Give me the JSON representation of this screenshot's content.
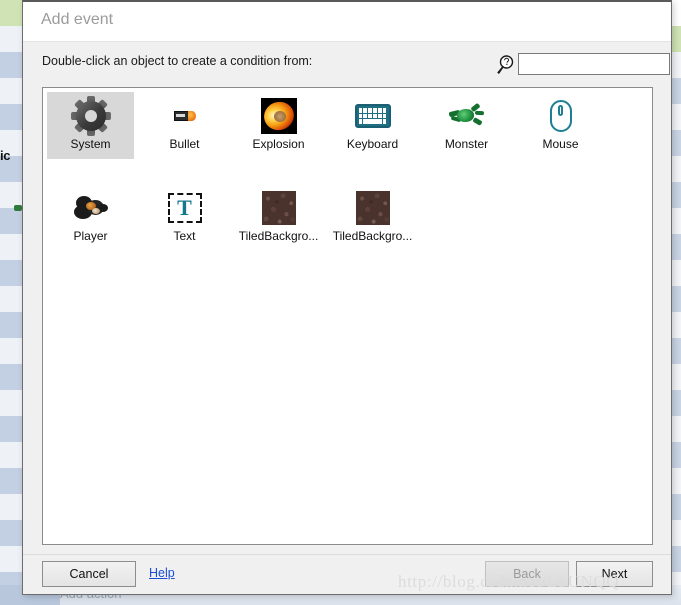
{
  "dialog": {
    "title": "Add event",
    "instruction": "Double-click an object to create a condition from:",
    "search": {
      "icon": "search-help-icon",
      "value": "",
      "placeholder": ""
    },
    "objects": [
      {
        "label": "System",
        "icon": "gear-icon",
        "selected": true
      },
      {
        "label": "Bullet",
        "icon": "bullet-icon",
        "selected": false
      },
      {
        "label": "Explosion",
        "icon": "explosion-icon",
        "selected": false
      },
      {
        "label": "Keyboard",
        "icon": "keyboard-icon",
        "selected": false
      },
      {
        "label": "Monster",
        "icon": "monster-icon",
        "selected": false
      },
      {
        "label": "Mouse",
        "icon": "mouse-icon",
        "selected": false
      },
      {
        "label": "Player",
        "icon": "player-icon",
        "selected": false
      },
      {
        "label": "Text",
        "icon": "text-object-icon",
        "selected": false
      },
      {
        "label": "TiledBackgro...",
        "icon": "tiled-background-icon",
        "selected": false
      },
      {
        "label": "TiledBackgro...",
        "icon": "tiled-background-icon",
        "selected": false
      }
    ],
    "footer": {
      "cancel_label": "Cancel",
      "help_label": "Help",
      "back_label": "Back",
      "next_label": "Next"
    }
  },
  "background": {
    "ic_label": "ic",
    "add_action_label": "Add action"
  },
  "watermark": {
    "text": "http://blog.csdn.net/LSUNQQ"
  },
  "colors": {
    "accent_teal": "#1e7f92",
    "link_blue": "#1a4fd6",
    "selection_gray": "#d8d8d8",
    "dialog_bg": "#f0f0f0"
  }
}
